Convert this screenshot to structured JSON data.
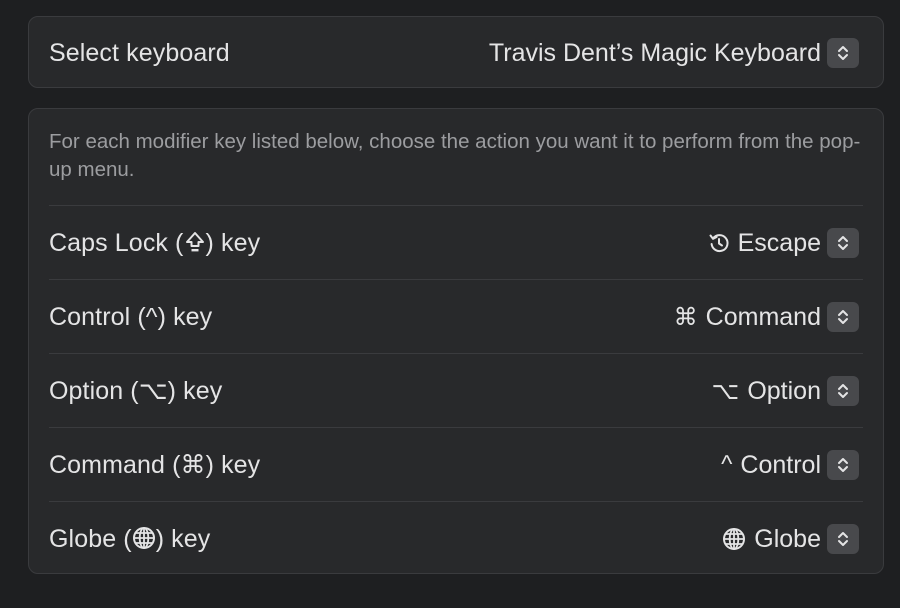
{
  "keyboard": {
    "label": "Select keyboard",
    "value": "Travis Dent’s Magic Keyboard"
  },
  "modifiers": {
    "description": "For each modifier key listed below, choose the action you want it to perform from the pop-up menu.",
    "rows": [
      {
        "label_prefix": "Caps Lock (",
        "label_icon": "caps-lock-icon",
        "label_suffix": ") key",
        "value_icon": "restore-icon",
        "value": "Escape"
      },
      {
        "label_prefix": "Control (",
        "label_glyph": "^",
        "label_suffix": ") key",
        "value_glyph": "⌘",
        "value": "Command"
      },
      {
        "label_prefix": "Option (",
        "label_glyph": "⌥",
        "label_suffix": ") key",
        "value_glyph": "⌥",
        "value": "Option"
      },
      {
        "label_prefix": "Command (",
        "label_glyph": "⌘",
        "label_suffix": ") key",
        "value_glyph": "^",
        "value": "Control"
      },
      {
        "label_prefix": "Globe (",
        "label_icon": "globe-icon",
        "label_suffix": ") key",
        "value_icon": "globe-icon",
        "value": "Globe"
      }
    ]
  },
  "colors": {
    "background": "#1e1f21",
    "panel": "#28292b",
    "border": "#3a3b3e",
    "text": "#e4e4e5",
    "secondary_text": "#9c9da0",
    "stepper": "#48494c"
  }
}
